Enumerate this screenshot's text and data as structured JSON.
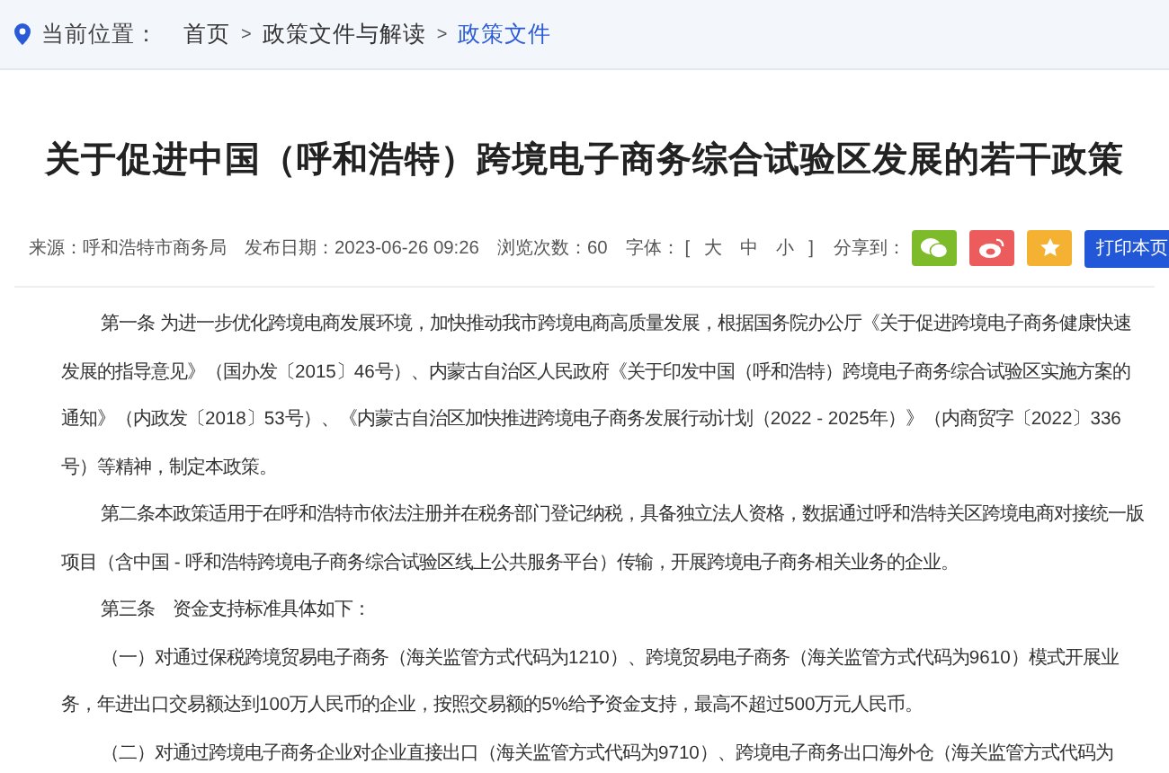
{
  "breadcrumb": {
    "label": "当前位置：",
    "items": [
      {
        "text": "首页",
        "selected": false
      },
      {
        "text": "政策文件与解读",
        "selected": false
      },
      {
        "text": "政策文件",
        "selected": true
      }
    ],
    "separator": ">"
  },
  "title": "关于促进中国（呼和浩特）跨境电子商务综合试验区发展的若干政策",
  "meta": {
    "source": "来源：呼和浩特市商务局",
    "date": "发布日期：2023-06-26 09:26",
    "views": "浏览次数：60",
    "font_label": "字体：",
    "bracket_open": "[",
    "sizes": [
      "大",
      "中",
      "小"
    ],
    "bracket_close": "]",
    "share_label": "分享到：",
    "print": "打印本页"
  },
  "paragraphs": [
    {
      "lines": [
        "第一条 为进一步优化跨境电商发展环境，加快推动我市跨境电商高质量发展，根据国务院办公厅《关于促进跨境电子商务健康快速",
        "发展的指导意见》（国办发〔2015〕46号）、内蒙古自治区人民政府《关于印发中国（呼和浩特）跨境电子商务综合试验区实施方案的",
        "通知》（内政发〔2018〕53号）、《内蒙古自治区加快推进跨境电子商务发展行动计划（2022 - 2025年）》（内商贸字〔2022〕336",
        "号）等精神，制定本政策。"
      ]
    },
    {
      "lines": [
        "第二条本政策适用于在呼和浩特市依法注册并在税务部门登记纳税，具备独立法人资格，数据通过呼和浩特关区跨境电商对接统一版",
        "项目（含中国 - 呼和浩特跨境电子商务综合试验区线上公共服务平台）传输，开展跨境电子商务相关业务的企业。"
      ]
    },
    {
      "lines": [
        "第三条　资金支持标准具体如下："
      ]
    },
    {
      "lines": [
        "（一）对通过保税跨境贸易电子商务（海关监管方式代码为1210）、跨境贸易电子商务（海关监管方式代码为9610）模式开展业",
        "务，年进出口交易额达到100万人民币的企业，按照交易额的5%给予资金支持，最高不超过500万元人民币。"
      ]
    },
    {
      "lines": [
        "（二）对通过跨境电子商务企业对企业直接出口（海关监管方式代码为9710）、跨境电子商务出口海外仓（海关监管方式代码为"
      ]
    }
  ]
}
